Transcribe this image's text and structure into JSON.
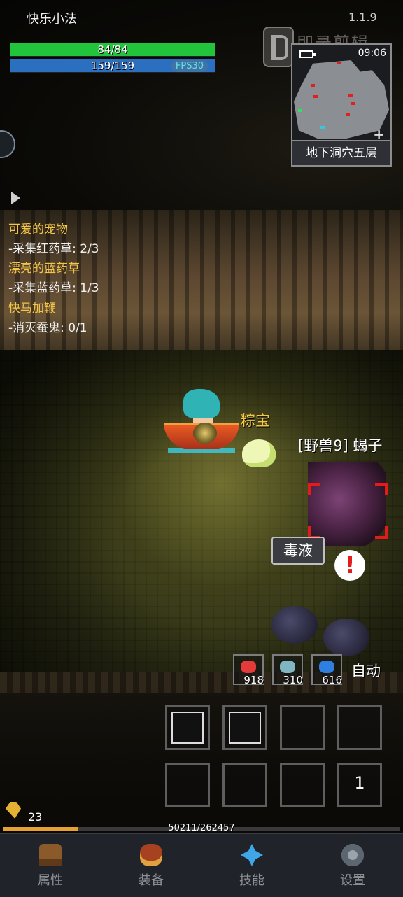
{
  "game": {
    "player_name": "快乐小法",
    "version": "1.1.9"
  },
  "status": {
    "hp_text": "84/84",
    "hp_fraction": 1.0,
    "mp_text": "159/159",
    "mp_fraction": 1.0,
    "fps_text": "FPS30"
  },
  "watermark": {
    "text": "即录剪辑"
  },
  "minimap": {
    "clock": "09:06",
    "location": "地下洞穴五层",
    "add_symbol": "+"
  },
  "quests": [
    {
      "title": "可爱的宠物",
      "task": "-采集红药草: 2/3"
    },
    {
      "title": "漂亮的蓝药草",
      "task": "-采集蓝药草: 1/3"
    },
    {
      "title": "快马加鞭",
      "task": "-消灭蚕鬼: 0/1"
    }
  ],
  "scene": {
    "pet_name": "粽宝",
    "enemy_name": "[野兽9] 蝎子",
    "enemy_skill": "毒液",
    "alert_symbol": "!"
  },
  "consumables": [
    {
      "icon": "red-herb-icon",
      "color": "#e33a3a",
      "count": "918"
    },
    {
      "icon": "fish-icon",
      "color": "#7fb6c2",
      "count": "310"
    },
    {
      "icon": "blue-herb-icon",
      "color": "#2e7fe0",
      "count": "616"
    }
  ],
  "auto_label": "自动",
  "skill_slots": [
    {
      "icon": "whirlwind-skill-icon",
      "label": ""
    },
    {
      "icon": "slash-skill-icon",
      "label": ""
    },
    {
      "icon": "",
      "label": ""
    },
    {
      "icon": "",
      "label": ""
    },
    {
      "icon": "",
      "label": ""
    },
    {
      "icon": "",
      "label": ""
    },
    {
      "icon": "",
      "label": ""
    },
    {
      "icon": "",
      "label": "1"
    }
  ],
  "resources": {
    "gold": "23",
    "exp_text": "50211/262457",
    "exp_fraction": 0.191
  },
  "nav": [
    {
      "label": "属性",
      "icon": "helmet-icon"
    },
    {
      "label": "装备",
      "icon": "bag-icon"
    },
    {
      "label": "技能",
      "icon": "skill-gem-icon"
    },
    {
      "label": "设置",
      "icon": "gear-icon"
    }
  ],
  "colors": {
    "hp": "#22c43b",
    "mp": "#2a6fc0",
    "quest_title": "#f2c548",
    "exp": "#e6a132"
  }
}
